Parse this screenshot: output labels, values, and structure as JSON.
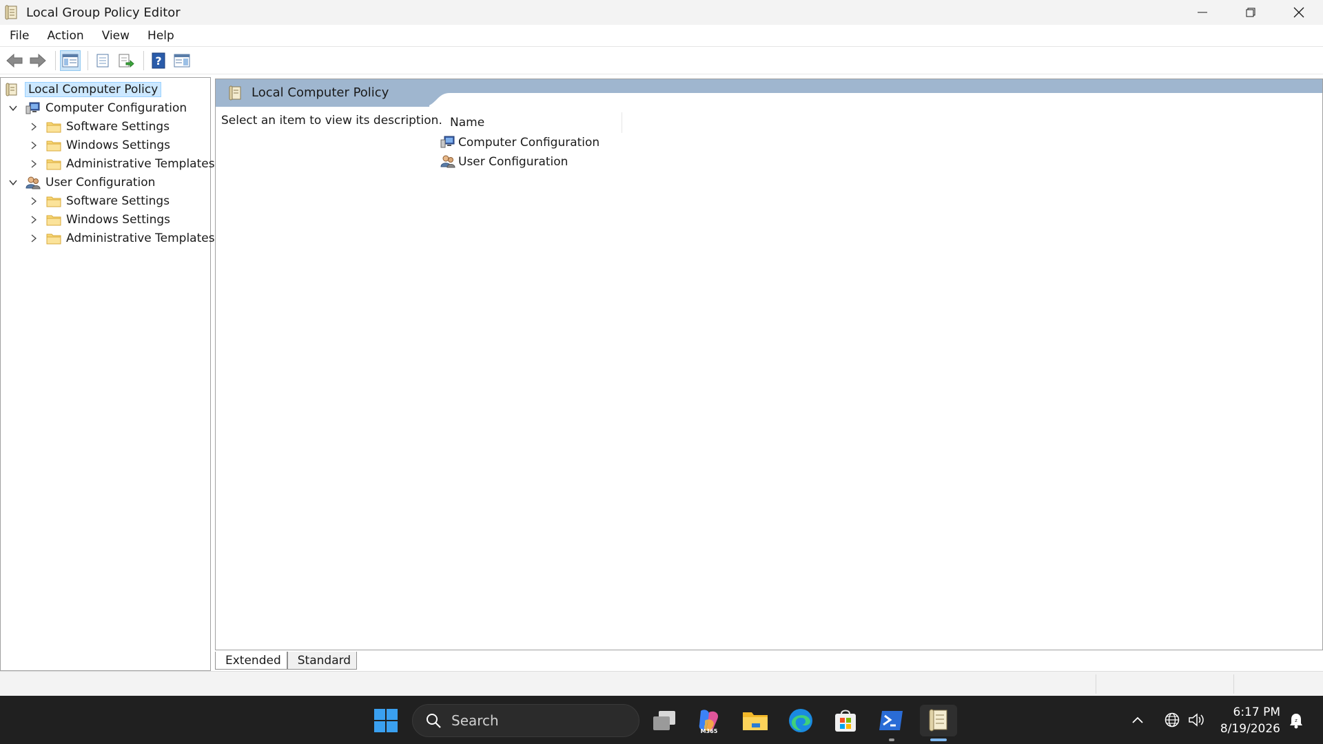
{
  "window": {
    "title": "Local Group Policy Editor"
  },
  "menu": [
    "File",
    "Action",
    "View",
    "Help"
  ],
  "tree": {
    "root": "Local Computer Policy",
    "computer_configuration": {
      "label": "Computer Configuration",
      "children": [
        "Software Settings",
        "Windows Settings",
        "Administrative Templates"
      ]
    },
    "user_configuration": {
      "label": "User Configuration",
      "children": [
        "Software Settings",
        "Windows Settings",
        "Administrative Templates"
      ]
    }
  },
  "details": {
    "header_title": "Local Computer Policy",
    "description": "Select an item to view its description.",
    "column_name": "Name",
    "items": [
      "Computer Configuration",
      "User Configuration"
    ]
  },
  "view_tabs": [
    "Extended",
    "Standard"
  ],
  "taskbar": {
    "search_placeholder": "Search",
    "time": "6:17 PM",
    "date": "8/19/2026",
    "m365_label": "M365"
  },
  "colors": {
    "header_band": "#9fb6cf",
    "selection": "#cce8ff",
    "taskbar": "#202020",
    "accent": "#0067c0"
  }
}
